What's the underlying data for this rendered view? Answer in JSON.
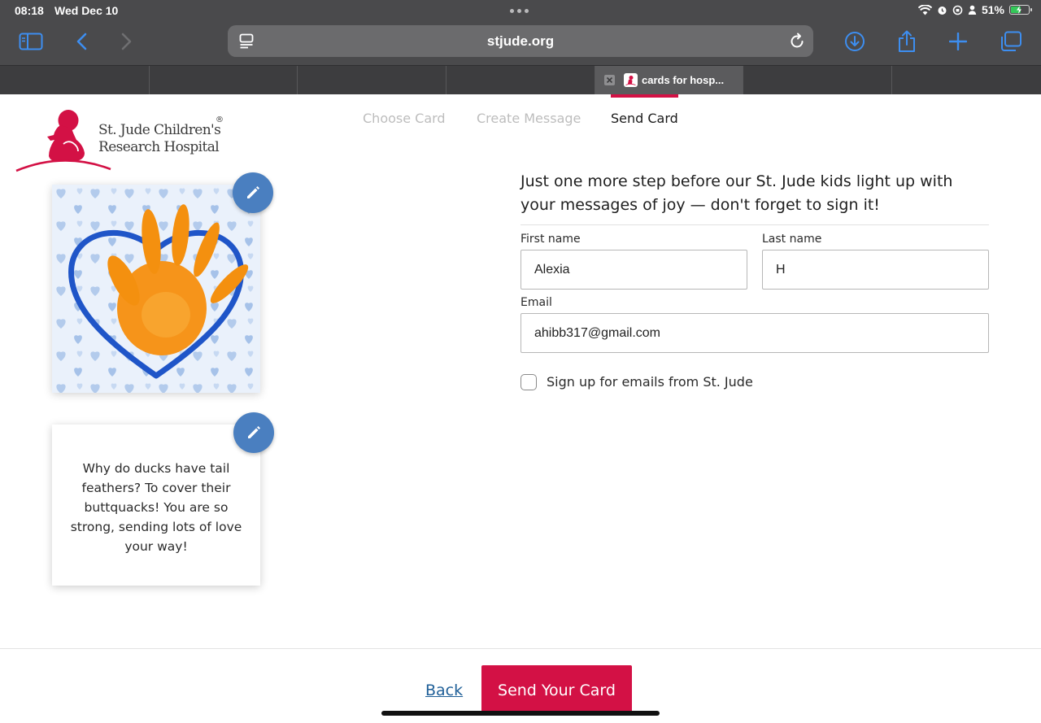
{
  "status_bar": {
    "time": "08:18",
    "date": "Wed Dec 10",
    "battery": "51%",
    "battery_level": 0.51
  },
  "browser": {
    "address": "stjude.org"
  },
  "tabs": [
    {
      "title": ""
    },
    {
      "title": ""
    },
    {
      "title": ""
    },
    {
      "title": ""
    },
    {
      "title": "cards for hosp..."
    },
    {
      "title": ""
    },
    {
      "title": ""
    }
  ],
  "logo": {
    "line1": "St. Jude Children's",
    "line2": "Research Hospital",
    "registered": "®"
  },
  "steps": [
    {
      "label": "Choose Card",
      "active": false
    },
    {
      "label": "Create Message",
      "active": false
    },
    {
      "label": "Send Card",
      "active": true
    }
  ],
  "card": {
    "message": "Why do ducks have tail feathers? To cover their buttquacks! You are so strong, sending lots of love your way!"
  },
  "form": {
    "heading": "Just one more step before our St. Jude kids light up with your messages of joy — don't forget to sign it!",
    "first_name_label": "First name",
    "first_name_value": "Alexia",
    "last_name_label": "Last name",
    "last_name_value": "H",
    "email_label": "Email",
    "email_value": "ahibb317@gmail.com",
    "signup_label": "Sign up for emails from St. Jude",
    "signup_checked": false
  },
  "footer": {
    "back_label": "Back",
    "send_label": "Send Your Card"
  },
  "colors": {
    "brand_red": "#d31145",
    "edit_blue": "#4a7fc0",
    "link_blue": "#1f5f98",
    "chrome_dark": "#4a4a4c",
    "safari_blue": "#3d8ef0"
  }
}
